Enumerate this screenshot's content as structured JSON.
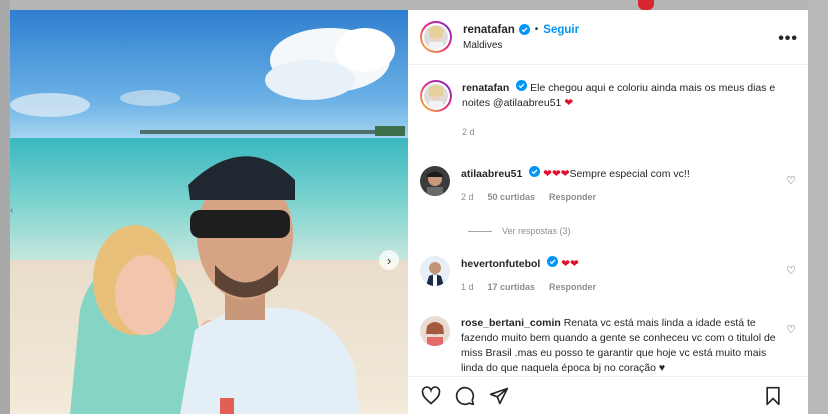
{
  "post": {
    "username": "renatafan",
    "follow_label": "Seguir",
    "location": "Maldives",
    "dot": "•",
    "caption_user": "renatafan",
    "caption_text": "Ele chegou aqui e coloriu ainda mais os meus dias e noites @atilaabreu51",
    "caption_emoji": "❤",
    "caption_time": "2 d"
  },
  "comments": [
    {
      "username": "atilaabreu51",
      "text_hearts": "❤❤❤",
      "text": "Sempre especial com vc!!",
      "time": "2 d",
      "likes": "50 curtidas",
      "reply_label": "Responder",
      "view_replies": "Ver respostas (3)"
    },
    {
      "username": "hevertonfutebol",
      "text_hearts": "❤❤",
      "text": "",
      "time": "1 d",
      "likes": "17 curtidas",
      "reply_label": "Responder"
    },
    {
      "username": "rose_bertani_comin",
      "text": "Renata vc está mais linda a idade está te fazendo muito bem quando a gente se conheceu vc com o titulol de miss Brasil .mas eu posso te garantir que hoje vc está muito mais linda do que naquela época bj no coração",
      "text_end": "♥"
    }
  ],
  "icons": {
    "more": "more-options-icon",
    "like": "heart-icon",
    "comment": "comment-icon",
    "share": "share-icon",
    "save": "bookmark-icon",
    "next": "chevron-right-icon",
    "verified": "verified-badge-icon"
  },
  "colors": {
    "accent": "#0095f6",
    "heart": "#e0102a",
    "text": "#262626",
    "muted": "#8e8e8e"
  }
}
